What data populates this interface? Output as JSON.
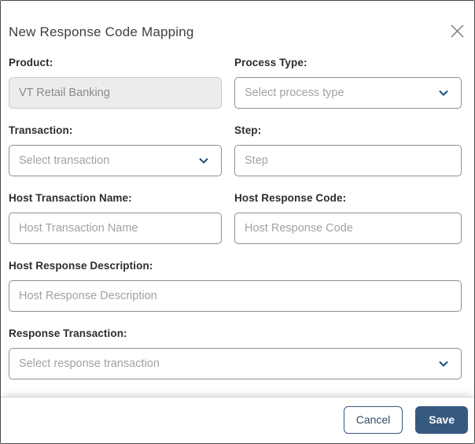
{
  "modal": {
    "title": "New Response Code Mapping"
  },
  "fields": {
    "product": {
      "label": "Product:",
      "value": "VT Retail Banking",
      "disabled": true
    },
    "process_type": {
      "label": "Process Type:",
      "placeholder": "Select process type"
    },
    "transaction": {
      "label": "Transaction:",
      "placeholder": "Select transaction"
    },
    "step": {
      "label": "Step:",
      "placeholder": "Step"
    },
    "host_transaction_name": {
      "label": "Host Transaction Name:",
      "placeholder": "Host Transaction Name"
    },
    "host_response_code": {
      "label": "Host Response Code:",
      "placeholder": "Host Response Code"
    },
    "host_response_description": {
      "label": "Host Response Description:",
      "placeholder": "Host Response Description"
    },
    "response_transaction": {
      "label": "Response Transaction:",
      "placeholder": "Select response transaction"
    }
  },
  "footer": {
    "cancel_label": "Cancel",
    "save_label": "Save"
  },
  "icons": {
    "close": "close-icon",
    "chevron": "chevron-down-icon"
  },
  "colors": {
    "primary": "#35597f",
    "chevron": "#1d4e79",
    "field_border": "#8f8f8f",
    "disabled_bg": "#ececec",
    "placeholder": "#a2a2a2"
  }
}
